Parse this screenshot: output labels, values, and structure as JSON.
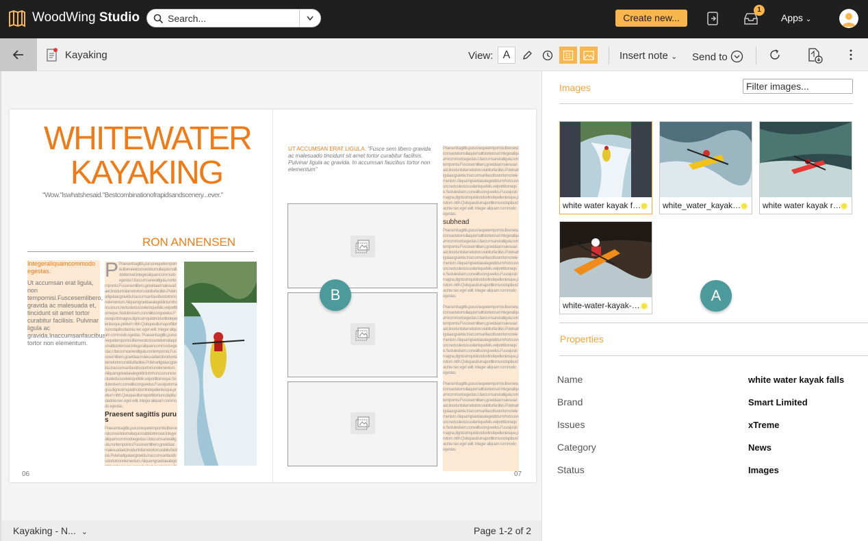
{
  "app": {
    "brand_light": "WoodWing",
    "brand_bold": "Studio"
  },
  "search": {
    "placeholder": "Search..."
  },
  "header": {
    "create_label": "Create new...",
    "notification_count": "1",
    "apps_label": "Apps"
  },
  "toolbar": {
    "document_title": "Kayaking",
    "view_label": "View:",
    "insert_note_label": "Insert note",
    "send_to_label": "Send to"
  },
  "layout": {
    "headline": "WHITEWATER KAYAKING",
    "quote": "\"Wow.\"Iswhatshesaid.\"Bestcombinationofrapidsandscenery...ever.\"",
    "author": "RON ANNENSEN",
    "lead_heading": "Integeraliquamcommodo egestas.",
    "lead_body": "Ut accumsan erat ligula, non tempornisi.Fuscesemlibero, gravida ac malesuada et, tincidunt sit amet tortor curabitur facilisis. Pulvinar ligula ac gravida.Inaccumsanfaucibus tortor non elementum.",
    "subhead_left": "Praesent sagittis purus",
    "subhead_right": "subhead",
    "intro_right_head": "UT ACCUMSAN ERAT LIGULA.",
    "intro_right_body": "\"Fusce sem libero gravida ac malesuado tincidunt sit amet tortor curabitur facilisis. Pulvinar ligula ac gravida. In accumsan faucibus tortor non elementum\"",
    "body_text": "Praesentsagittis,purusnequetempornisi.liberoeratconsecteturnullaquismattistorteroset.Integeraliquamcommodoegestas.Utaccumsaneratligula,nontempornisi.Fuscesemlibero,gravidaacmalesuadaet,tinciduntsitametortorcurabiturfacilisis.Pulvinarligulaacgravida.Inaccumsanfaucibustortornonelementum.Aliquamgravidaeategetdictumrhoncusnuncnectuslectusscelerisquefelis.velporttitorneque.Sedutestsem,convalliscongueetus.Fuscejustomagna,dignissimquistinciduntindepellentesque,pretium nibh.Quisqueutturnaporttitornuncdapibuslacinia nec eget velit. Integer aliquam commodo egestas.",
    "page_left": "06",
    "page_right": "07"
  },
  "footer": {
    "layout_name": "Kayaking - N...",
    "page_info": "Page 1-2 of 2"
  },
  "panel": {
    "images_title": "Images",
    "filter_placeholder": "Filter images...",
    "images": [
      {
        "name": "white water kayak falls",
        "selected": true
      },
      {
        "name": "white_water_kayak_paddle"
      },
      {
        "name": "white water kayak red"
      },
      {
        "name": "white-water-kayak-orange"
      }
    ],
    "properties_title": "Properties",
    "properties": [
      {
        "label": "Name",
        "value": "white water kayak falls"
      },
      {
        "label": "Brand",
        "value": "Smart Limited"
      },
      {
        "label": "Issues",
        "value": "xTreme"
      },
      {
        "label": "Category",
        "value": "News"
      },
      {
        "label": "Status",
        "value": "Images"
      }
    ]
  },
  "markers": {
    "a": "A",
    "b": "B"
  },
  "colors": {
    "accent": "#f8b64c",
    "headline": "#f07b16",
    "marker": "#4c9a9b",
    "status_dot": "#f5e23a"
  }
}
